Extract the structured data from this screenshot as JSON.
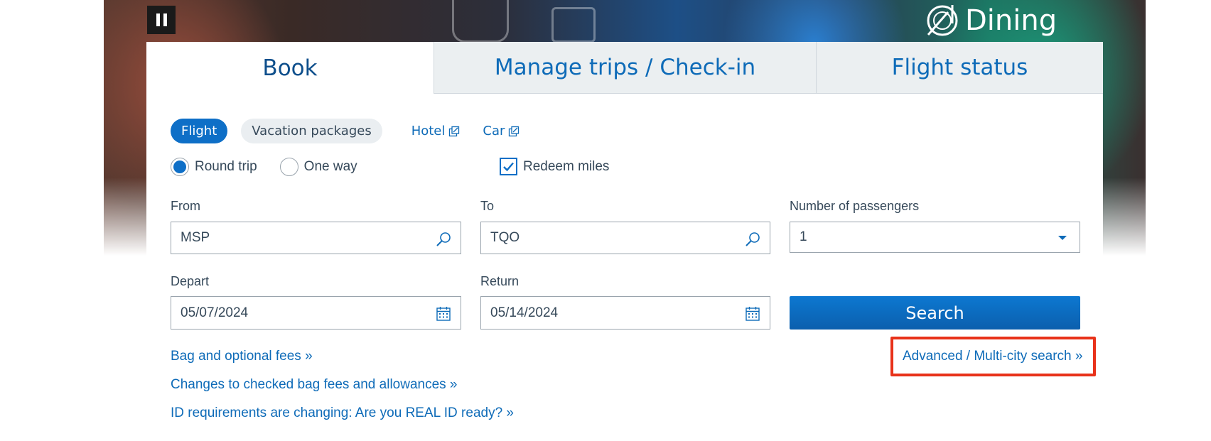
{
  "hero": {
    "brand_text": "Dining",
    "pause_icon": "pause-icon"
  },
  "tabs": [
    {
      "label": "Book",
      "active": true
    },
    {
      "label": "Manage trips / Check-in",
      "active": false
    },
    {
      "label": "Flight status",
      "active": false
    }
  ],
  "booking_types": {
    "flight": "Flight",
    "vacation": "Vacation packages",
    "hotel": "Hotel",
    "car": "Car"
  },
  "trip_type": {
    "round_trip": "Round trip",
    "one_way": "One way",
    "selected": "round_trip"
  },
  "redeem_miles": {
    "label": "Redeem miles",
    "checked": true
  },
  "from": {
    "label": "From",
    "value": "MSP"
  },
  "to": {
    "label": "To",
    "value": "TQO"
  },
  "passengers": {
    "label": "Number of passengers",
    "value": "1"
  },
  "depart": {
    "label": "Depart",
    "value": "05/07/2024"
  },
  "return": {
    "label": "Return",
    "value": "05/14/2024"
  },
  "search_button": "Search",
  "links": {
    "bag_fees": "Bag and optional fees »",
    "checked_bag": "Changes to checked bag fees and allowances »",
    "real_id": "ID requirements are changing: Are you REAL ID ready? »",
    "advanced": "Advanced / Multi-city search »"
  },
  "colors": {
    "accent": "#0e6fc7",
    "link": "#0e6bb8",
    "highlight": "#e8321a"
  }
}
